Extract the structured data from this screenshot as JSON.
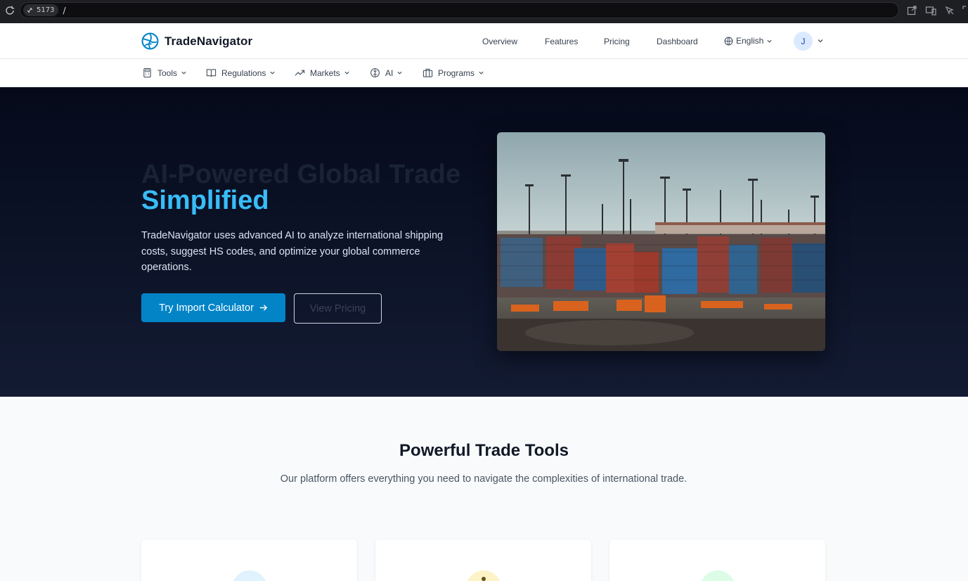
{
  "browser": {
    "port_label": "5173",
    "path": "/"
  },
  "header": {
    "brand": "TradeNavigator",
    "links": [
      {
        "label": "Overview"
      },
      {
        "label": "Features"
      },
      {
        "label": "Pricing"
      },
      {
        "label": "Dashboard"
      }
    ],
    "language": "English",
    "avatar_initial": "J"
  },
  "subnav": {
    "items": [
      {
        "label": "Tools",
        "icon": "calculator-icon"
      },
      {
        "label": "Regulations",
        "icon": "book-icon"
      },
      {
        "label": "Markets",
        "icon": "trending-up-icon"
      },
      {
        "label": "AI",
        "icon": "brain-icon"
      },
      {
        "label": "Programs",
        "icon": "briefcase-icon"
      }
    ]
  },
  "hero": {
    "title_line1": "AI-Powered Global Trade",
    "title_line2": "Simplified",
    "description": "TradeNavigator uses advanced AI to analyze international shipping costs, suggest HS codes, and optimize your global commerce operations.",
    "primary_button": "Try Import Calculator",
    "secondary_button": "View Pricing",
    "image_alt": "container port terminal"
  },
  "tools_section": {
    "title": "Powerful Trade Tools",
    "subtitle": "Our platform offers everything you need to navigate the complexities of international trade."
  },
  "colors": {
    "accent": "#0284c7",
    "highlight": "#38bdf8",
    "hero_bg": "#0b1226",
    "card_icon_1": "#e0f2fe",
    "card_icon_2": "#fef3c7",
    "card_icon_3": "#dcfce7"
  }
}
